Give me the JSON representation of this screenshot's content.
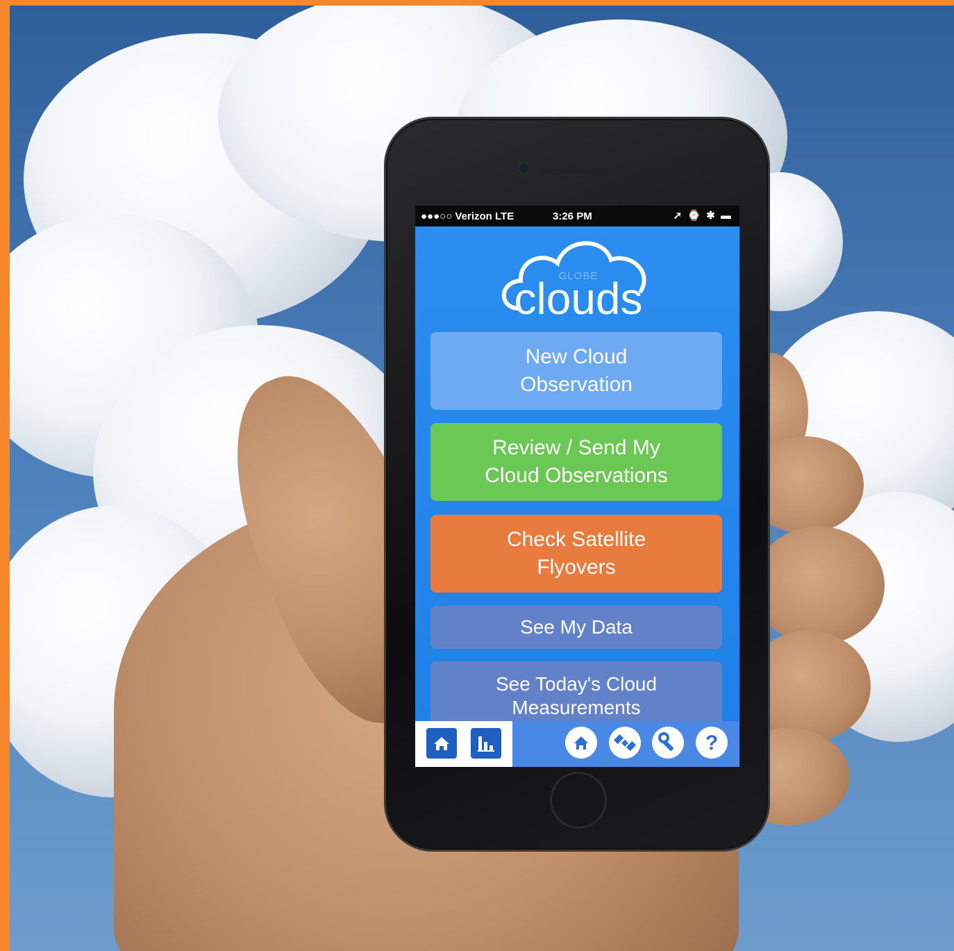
{
  "status_bar": {
    "carrier": "●●●○○ Verizon  LTE",
    "time": "3:26 PM",
    "indicators": "➚ ⌚ ✱ ▬"
  },
  "logo": {
    "small_text": "GLOBE",
    "main_text": "clouds"
  },
  "menu": {
    "new_observation": [
      "New Cloud",
      "Observation"
    ],
    "review_send": [
      "Review / Send My",
      "Cloud Observations"
    ],
    "satellite": [
      "Check Satellite",
      "Flyovers"
    ],
    "my_data": "See My Data",
    "todays_measurements": [
      "See Today's Cloud",
      "Measurements"
    ]
  },
  "tab_bar": {
    "icons": [
      "home-icon",
      "chart-icon",
      "home-circle-icon",
      "satellite-icon",
      "wrench-icon",
      "help-icon"
    ],
    "help_glyph": "?"
  },
  "colors": {
    "screen_blue": "#2c8ef0",
    "new_observation": "#6eaaf3",
    "review_send": "#6bc855",
    "satellite": "#e87b3e",
    "secondary": "#6182c9",
    "border": "#f7872b"
  }
}
